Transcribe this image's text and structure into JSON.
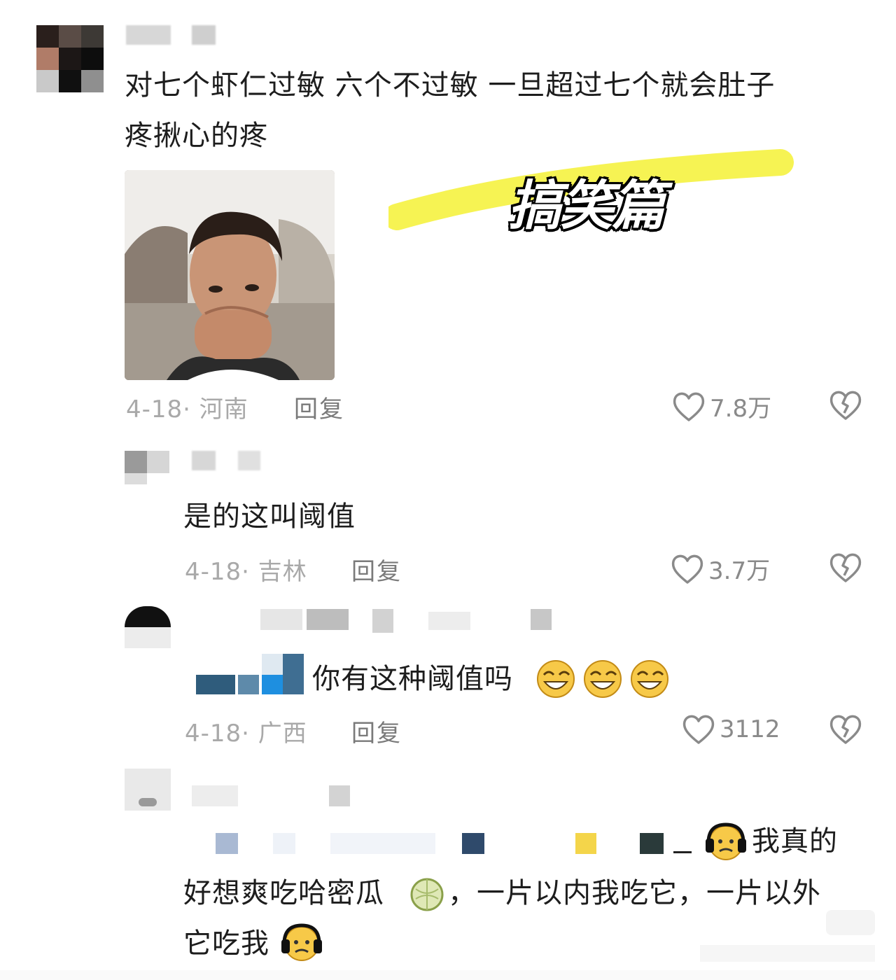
{
  "overlay": {
    "title": "搞笑篇",
    "highlight_color": "#f5f24a"
  },
  "comments": [
    {
      "text_line1": "对七个虾仁过敏 六个不过敏 一旦超过七个就会肚子",
      "text_line2": "疼揪心的疼",
      "date": "4-18",
      "region": "河南",
      "reply_label": "回复",
      "likes": "7.8万"
    },
    {
      "text": "是的这叫阈值",
      "date": "4-18",
      "region": "吉林",
      "reply_label": "回复",
      "likes": "3.7万"
    },
    {
      "text": "你有这种阈值吗",
      "date": "4-18",
      "region": "广西",
      "reply_label": "回复",
      "likes": "3112"
    },
    {
      "text_line1": "我真的",
      "text_line2a": "好想爽吃哈密瓜",
      "text_line2b": "，一片以内我吃它，一片以外",
      "text_line3": "它吃我"
    }
  ],
  "meta_sep": "·",
  "colors": {
    "meta": "#a9a9a9",
    "icon": "#8a8a8a",
    "accent_yellow": "#f5f24a"
  },
  "icons": [
    "heart-icon",
    "broken-heart-icon",
    "grin-emoji-icon",
    "headphone-emoji-icon",
    "melon-emoji-icon"
  ]
}
